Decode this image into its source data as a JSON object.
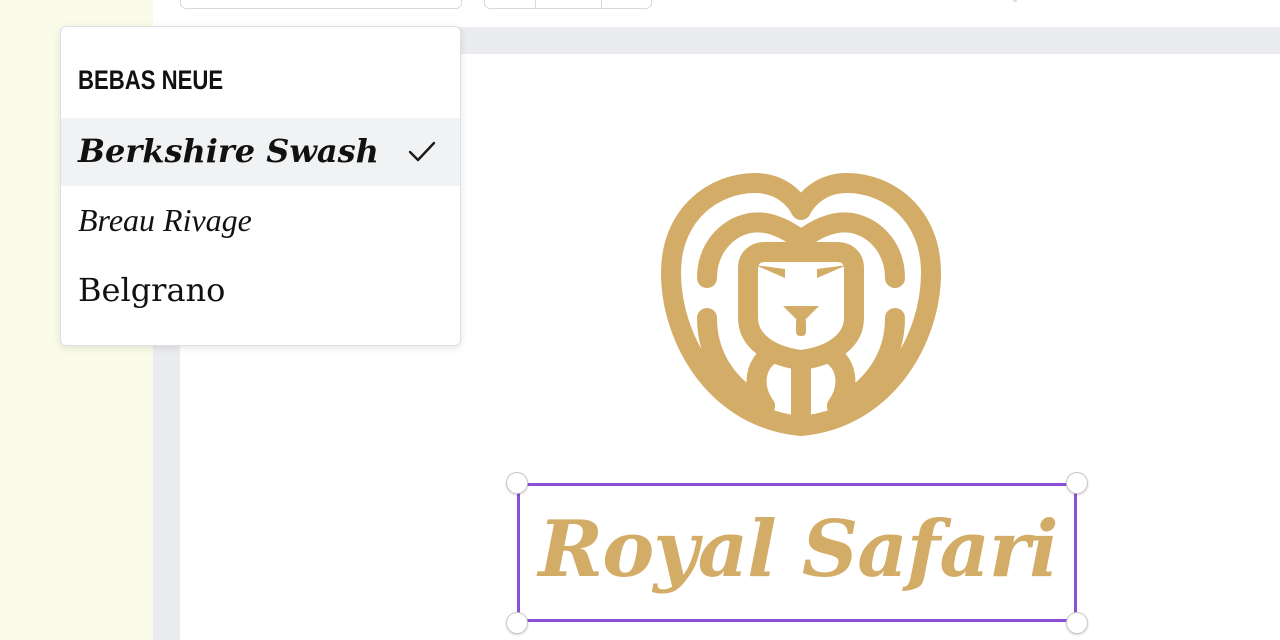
{
  "font_menu": {
    "items": [
      {
        "label": "BEBAS NEUE"
      },
      {
        "label": "Berkshire Swash",
        "selected": true
      },
      {
        "label": "Breau Rivage"
      },
      {
        "label": "Belgrano"
      }
    ]
  },
  "canvas": {
    "logo": {
      "icon": "lion-head-icon",
      "color": "#d3ad67"
    },
    "title_text": "Royal Safari",
    "title_color": "#d3ad67",
    "selection_color": "#8b4fd8"
  }
}
